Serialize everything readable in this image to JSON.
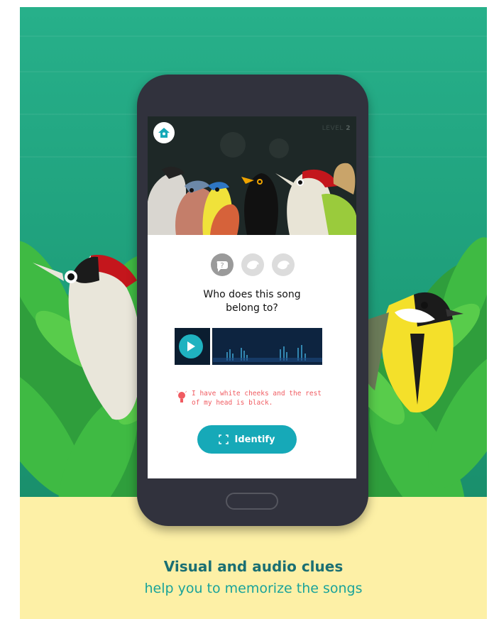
{
  "screen": {
    "level_prefix": "LEVEL",
    "level_number": "2",
    "question": "Who does this song belong to?",
    "question_line1": "Who does this song",
    "question_line2": "belong to?",
    "hint_line1": "I have white cheeks and the rest",
    "hint_line2": "of my head is black.",
    "identify_label": "Identify"
  },
  "tagline": {
    "title": "Visual and audio clues",
    "subtitle": "help you to memorize the songs"
  },
  "icons": {
    "home": "birdhouse-home-icon",
    "play": "play-icon",
    "hint": "lightbulb-icon",
    "identify": "scan-frame-icon",
    "clue_audio": "sound-clue-icon",
    "clue_visual": "bird-clue-icon"
  },
  "colors": {
    "background_green": "#1e9e7a",
    "bottom_band": "#fdf0a6",
    "accent_teal": "#16a9b8",
    "hint_red": "#f05b61",
    "title_teal": "#1a6f73"
  }
}
